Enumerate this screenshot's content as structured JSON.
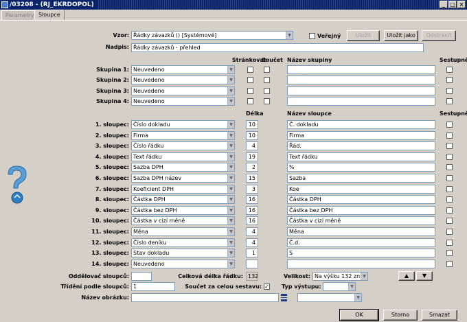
{
  "window": {
    "title": "/03208 - (RJ_EKRDOPOL)",
    "min": "_",
    "max": "□",
    "close": "×"
  },
  "tabs": [
    "Parametry",
    "Sloupce"
  ],
  "vzor": {
    "label": "Vzor:",
    "value": "Řádky závazků  ()  [Systémové]",
    "verejny": "Veřejný",
    "ulozit": "Uložit",
    "ulozit_jako": "Uložit jako",
    "odstranit": "Odstranit"
  },
  "nadpis": {
    "label": "Nadpis:",
    "value": "Řádky závazků - přehled"
  },
  "headers": {
    "strankovat": "Stránkovat",
    "soucet": "Součet",
    "nazev_skupiny": "Název skupiny",
    "sestupne": "Sestupně",
    "delka": "Délka",
    "nazev_sloupce": "Název sloupce",
    "sestupne2": "Sestupně"
  },
  "groups": [
    {
      "label": "Skupina 1:",
      "value": "Neuvedeno"
    },
    {
      "label": "Skupina 2:",
      "value": "Neuvedeno"
    },
    {
      "label": "Skupina 3:",
      "value": "Neuvedeno"
    },
    {
      "label": "Skupina 4:",
      "value": "Neuvedeno"
    }
  ],
  "columns": [
    {
      "label": "1. sloupec:",
      "value": "Číslo dokladu",
      "len": "10",
      "name": "Č. dokladu"
    },
    {
      "label": "2. sloupec:",
      "value": "Firma",
      "len": "10",
      "name": "Firma"
    },
    {
      "label": "3. sloupec:",
      "value": "Číslo řádku",
      "len": "4",
      "name": "Řád."
    },
    {
      "label": "4. sloupec:",
      "value": "Text řádku",
      "len": "19",
      "name": "Text řádku"
    },
    {
      "label": "5. sloupec:",
      "value": "Sazba DPH",
      "len": "2",
      "name": "%"
    },
    {
      "label": "6. sloupec:",
      "value": "Sazba DPH název",
      "len": "15",
      "name": "Sazba"
    },
    {
      "label": "7. sloupec:",
      "value": "Koeficient DPH",
      "len": "3",
      "name": "Koe"
    },
    {
      "label": "8. sloupec:",
      "value": "Částka DPH",
      "len": "16",
      "name": "Částka DPH"
    },
    {
      "label": "9. sloupec:",
      "value": "Částka bez DPH",
      "len": "16",
      "name": "Částka bez DPH"
    },
    {
      "label": "10. sloupec:",
      "value": "Částka v cizí měně",
      "len": "16",
      "name": "Částka v cizí měně"
    },
    {
      "label": "11. sloupec:",
      "value": "Měna",
      "len": "4",
      "name": "Měna"
    },
    {
      "label": "12. sloupec:",
      "value": "Číslo deníku",
      "len": "4",
      "name": "Č.d."
    },
    {
      "label": "13. sloupec:",
      "value": "Stav dokladu",
      "len": "1",
      "name": "S"
    },
    {
      "label": "14. sloupec:",
      "value": "Neuvedeno",
      "len": "",
      "name": ""
    }
  ],
  "footer": {
    "oddelovac": "Oddělovač sloupců:",
    "celkova": "Celková délka řádku:",
    "celkova_val": "132",
    "velikost": "Velikost:",
    "velikost_val": "Na výšku 132 zn.",
    "trideni": "Třídění podle sloupců:",
    "trideni_val": "1",
    "soucet": "Součet za celou sestavu:",
    "typ": "Typ výstupu:",
    "obrazek": "Název obrázku:"
  },
  "buttons": {
    "ok": "OK",
    "storno": "Storno",
    "smazat": "Smazat",
    "up": "▲",
    "down": "▼"
  }
}
